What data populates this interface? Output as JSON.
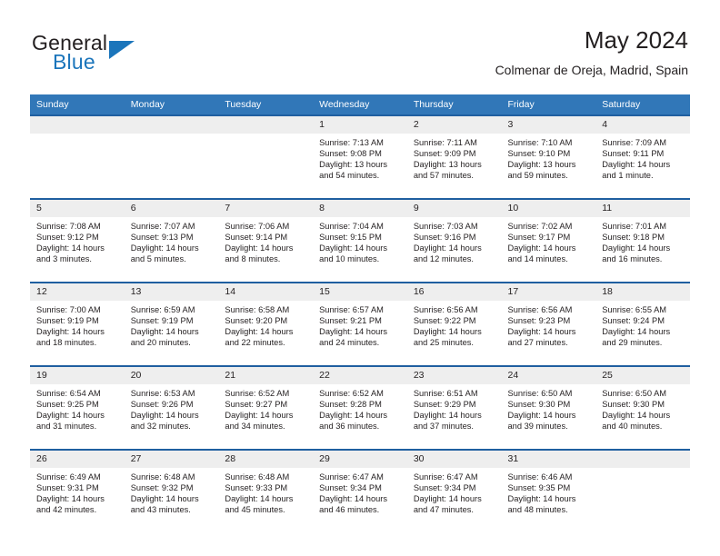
{
  "brand": {
    "name_part1": "General",
    "name_part2": "Blue",
    "accent_color": "#1b75bb"
  },
  "header": {
    "title": "May 2024",
    "subtitle": "Colmenar de Oreja, Madrid, Spain"
  },
  "theme": {
    "header_row_bg": "#3177b8",
    "row_divider": "#1f5fa0",
    "daynum_bg": "#eeeeee"
  },
  "calendar": {
    "weekday_headers": [
      "Sunday",
      "Monday",
      "Tuesday",
      "Wednesday",
      "Thursday",
      "Friday",
      "Saturday"
    ],
    "weeks": [
      [
        {
          "day": "",
          "empty": true,
          "sunrise": "",
          "sunset": "",
          "daylight_line1": "",
          "daylight_line2": ""
        },
        {
          "day": "",
          "empty": true,
          "sunrise": "",
          "sunset": "",
          "daylight_line1": "",
          "daylight_line2": ""
        },
        {
          "day": "",
          "empty": true,
          "sunrise": "",
          "sunset": "",
          "daylight_line1": "",
          "daylight_line2": ""
        },
        {
          "day": "1",
          "empty": false,
          "sunrise": "Sunrise: 7:13 AM",
          "sunset": "Sunset: 9:08 PM",
          "daylight_line1": "Daylight: 13 hours",
          "daylight_line2": "and 54 minutes."
        },
        {
          "day": "2",
          "empty": false,
          "sunrise": "Sunrise: 7:11 AM",
          "sunset": "Sunset: 9:09 PM",
          "daylight_line1": "Daylight: 13 hours",
          "daylight_line2": "and 57 minutes."
        },
        {
          "day": "3",
          "empty": false,
          "sunrise": "Sunrise: 7:10 AM",
          "sunset": "Sunset: 9:10 PM",
          "daylight_line1": "Daylight: 13 hours",
          "daylight_line2": "and 59 minutes."
        },
        {
          "day": "4",
          "empty": false,
          "sunrise": "Sunrise: 7:09 AM",
          "sunset": "Sunset: 9:11 PM",
          "daylight_line1": "Daylight: 14 hours",
          "daylight_line2": "and 1 minute."
        }
      ],
      [
        {
          "day": "5",
          "empty": false,
          "sunrise": "Sunrise: 7:08 AM",
          "sunset": "Sunset: 9:12 PM",
          "daylight_line1": "Daylight: 14 hours",
          "daylight_line2": "and 3 minutes."
        },
        {
          "day": "6",
          "empty": false,
          "sunrise": "Sunrise: 7:07 AM",
          "sunset": "Sunset: 9:13 PM",
          "daylight_line1": "Daylight: 14 hours",
          "daylight_line2": "and 5 minutes."
        },
        {
          "day": "7",
          "empty": false,
          "sunrise": "Sunrise: 7:06 AM",
          "sunset": "Sunset: 9:14 PM",
          "daylight_line1": "Daylight: 14 hours",
          "daylight_line2": "and 8 minutes."
        },
        {
          "day": "8",
          "empty": false,
          "sunrise": "Sunrise: 7:04 AM",
          "sunset": "Sunset: 9:15 PM",
          "daylight_line1": "Daylight: 14 hours",
          "daylight_line2": "and 10 minutes."
        },
        {
          "day": "9",
          "empty": false,
          "sunrise": "Sunrise: 7:03 AM",
          "sunset": "Sunset: 9:16 PM",
          "daylight_line1": "Daylight: 14 hours",
          "daylight_line2": "and 12 minutes."
        },
        {
          "day": "10",
          "empty": false,
          "sunrise": "Sunrise: 7:02 AM",
          "sunset": "Sunset: 9:17 PM",
          "daylight_line1": "Daylight: 14 hours",
          "daylight_line2": "and 14 minutes."
        },
        {
          "day": "11",
          "empty": false,
          "sunrise": "Sunrise: 7:01 AM",
          "sunset": "Sunset: 9:18 PM",
          "daylight_line1": "Daylight: 14 hours",
          "daylight_line2": "and 16 minutes."
        }
      ],
      [
        {
          "day": "12",
          "empty": false,
          "sunrise": "Sunrise: 7:00 AM",
          "sunset": "Sunset: 9:19 PM",
          "daylight_line1": "Daylight: 14 hours",
          "daylight_line2": "and 18 minutes."
        },
        {
          "day": "13",
          "empty": false,
          "sunrise": "Sunrise: 6:59 AM",
          "sunset": "Sunset: 9:19 PM",
          "daylight_line1": "Daylight: 14 hours",
          "daylight_line2": "and 20 minutes."
        },
        {
          "day": "14",
          "empty": false,
          "sunrise": "Sunrise: 6:58 AM",
          "sunset": "Sunset: 9:20 PM",
          "daylight_line1": "Daylight: 14 hours",
          "daylight_line2": "and 22 minutes."
        },
        {
          "day": "15",
          "empty": false,
          "sunrise": "Sunrise: 6:57 AM",
          "sunset": "Sunset: 9:21 PM",
          "daylight_line1": "Daylight: 14 hours",
          "daylight_line2": "and 24 minutes."
        },
        {
          "day": "16",
          "empty": false,
          "sunrise": "Sunrise: 6:56 AM",
          "sunset": "Sunset: 9:22 PM",
          "daylight_line1": "Daylight: 14 hours",
          "daylight_line2": "and 25 minutes."
        },
        {
          "day": "17",
          "empty": false,
          "sunrise": "Sunrise: 6:56 AM",
          "sunset": "Sunset: 9:23 PM",
          "daylight_line1": "Daylight: 14 hours",
          "daylight_line2": "and 27 minutes."
        },
        {
          "day": "18",
          "empty": false,
          "sunrise": "Sunrise: 6:55 AM",
          "sunset": "Sunset: 9:24 PM",
          "daylight_line1": "Daylight: 14 hours",
          "daylight_line2": "and 29 minutes."
        }
      ],
      [
        {
          "day": "19",
          "empty": false,
          "sunrise": "Sunrise: 6:54 AM",
          "sunset": "Sunset: 9:25 PM",
          "daylight_line1": "Daylight: 14 hours",
          "daylight_line2": "and 31 minutes."
        },
        {
          "day": "20",
          "empty": false,
          "sunrise": "Sunrise: 6:53 AM",
          "sunset": "Sunset: 9:26 PM",
          "daylight_line1": "Daylight: 14 hours",
          "daylight_line2": "and 32 minutes."
        },
        {
          "day": "21",
          "empty": false,
          "sunrise": "Sunrise: 6:52 AM",
          "sunset": "Sunset: 9:27 PM",
          "daylight_line1": "Daylight: 14 hours",
          "daylight_line2": "and 34 minutes."
        },
        {
          "day": "22",
          "empty": false,
          "sunrise": "Sunrise: 6:52 AM",
          "sunset": "Sunset: 9:28 PM",
          "daylight_line1": "Daylight: 14 hours",
          "daylight_line2": "and 36 minutes."
        },
        {
          "day": "23",
          "empty": false,
          "sunrise": "Sunrise: 6:51 AM",
          "sunset": "Sunset: 9:29 PM",
          "daylight_line1": "Daylight: 14 hours",
          "daylight_line2": "and 37 minutes."
        },
        {
          "day": "24",
          "empty": false,
          "sunrise": "Sunrise: 6:50 AM",
          "sunset": "Sunset: 9:30 PM",
          "daylight_line1": "Daylight: 14 hours",
          "daylight_line2": "and 39 minutes."
        },
        {
          "day": "25",
          "empty": false,
          "sunrise": "Sunrise: 6:50 AM",
          "sunset": "Sunset: 9:30 PM",
          "daylight_line1": "Daylight: 14 hours",
          "daylight_line2": "and 40 minutes."
        }
      ],
      [
        {
          "day": "26",
          "empty": false,
          "sunrise": "Sunrise: 6:49 AM",
          "sunset": "Sunset: 9:31 PM",
          "daylight_line1": "Daylight: 14 hours",
          "daylight_line2": "and 42 minutes."
        },
        {
          "day": "27",
          "empty": false,
          "sunrise": "Sunrise: 6:48 AM",
          "sunset": "Sunset: 9:32 PM",
          "daylight_line1": "Daylight: 14 hours",
          "daylight_line2": "and 43 minutes."
        },
        {
          "day": "28",
          "empty": false,
          "sunrise": "Sunrise: 6:48 AM",
          "sunset": "Sunset: 9:33 PM",
          "daylight_line1": "Daylight: 14 hours",
          "daylight_line2": "and 45 minutes."
        },
        {
          "day": "29",
          "empty": false,
          "sunrise": "Sunrise: 6:47 AM",
          "sunset": "Sunset: 9:34 PM",
          "daylight_line1": "Daylight: 14 hours",
          "daylight_line2": "and 46 minutes."
        },
        {
          "day": "30",
          "empty": false,
          "sunrise": "Sunrise: 6:47 AM",
          "sunset": "Sunset: 9:34 PM",
          "daylight_line1": "Daylight: 14 hours",
          "daylight_line2": "and 47 minutes."
        },
        {
          "day": "31",
          "empty": false,
          "sunrise": "Sunrise: 6:46 AM",
          "sunset": "Sunset: 9:35 PM",
          "daylight_line1": "Daylight: 14 hours",
          "daylight_line2": "and 48 minutes."
        },
        {
          "day": "",
          "empty": true,
          "sunrise": "",
          "sunset": "",
          "daylight_line1": "",
          "daylight_line2": ""
        }
      ]
    ]
  }
}
